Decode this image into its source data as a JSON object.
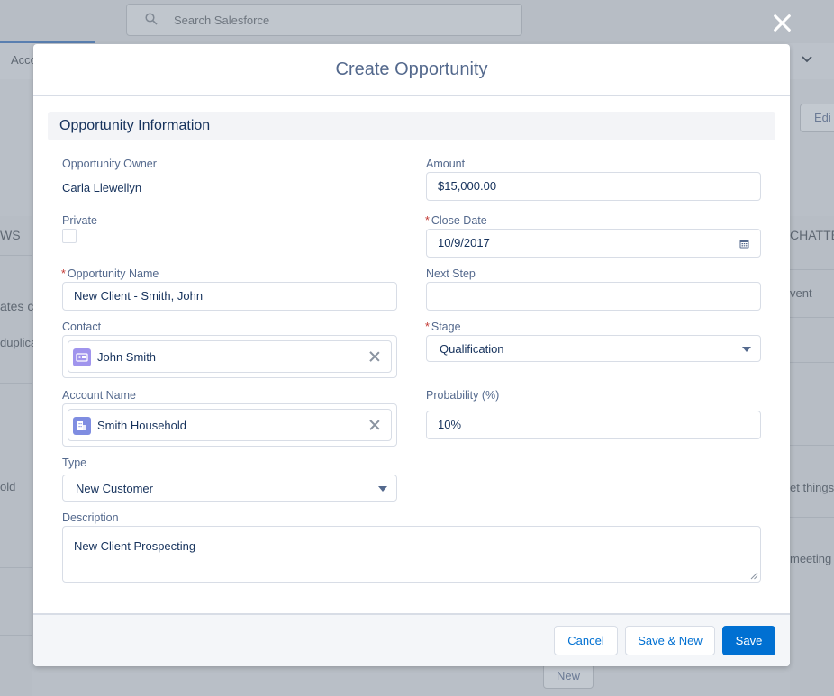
{
  "background": {
    "search_placeholder": "Search Salesforce",
    "tab_label": "Acco",
    "left_texts": [
      "WS",
      "ates c",
      "duplica",
      "old"
    ],
    "right_texts": [
      "CHATTE",
      "vent",
      "et things",
      "meeting"
    ],
    "edit_button": "Edi",
    "new_button": "New"
  },
  "modal": {
    "title": "Create Opportunity",
    "section_title": "Opportunity Information",
    "fields": {
      "owner": {
        "label": "Opportunity Owner",
        "value": "Carla Llewellyn"
      },
      "private": {
        "label": "Private",
        "checked": false
      },
      "opportunity_name": {
        "label": "Opportunity Name",
        "required_mark": "*",
        "value": "New Client - Smith, John"
      },
      "contact": {
        "label": "Contact",
        "value": "John Smith",
        "icon": "contact-card-icon"
      },
      "account_name": {
        "label": "Account Name",
        "value": "Smith Household",
        "icon": "account-building-icon"
      },
      "type": {
        "label": "Type",
        "value": "New Customer"
      },
      "description": {
        "label": "Description",
        "value": "New Client Prospecting"
      },
      "amount": {
        "label": "Amount",
        "value": "$15,000.00"
      },
      "close_date": {
        "label": "Close Date",
        "required_mark": "*",
        "value": "10/9/2017"
      },
      "next_step": {
        "label": "Next Step",
        "value": ""
      },
      "stage": {
        "label": "Stage",
        "required_mark": "*",
        "value": "Qualification"
      },
      "probability": {
        "label": "Probability (%)",
        "value": "10%"
      }
    },
    "buttons": {
      "cancel": "Cancel",
      "save_new": "Save & New",
      "save": "Save"
    }
  },
  "colors": {
    "brand": "#0070d2",
    "required": "#c23934",
    "pill_icon": "#a094ed"
  }
}
